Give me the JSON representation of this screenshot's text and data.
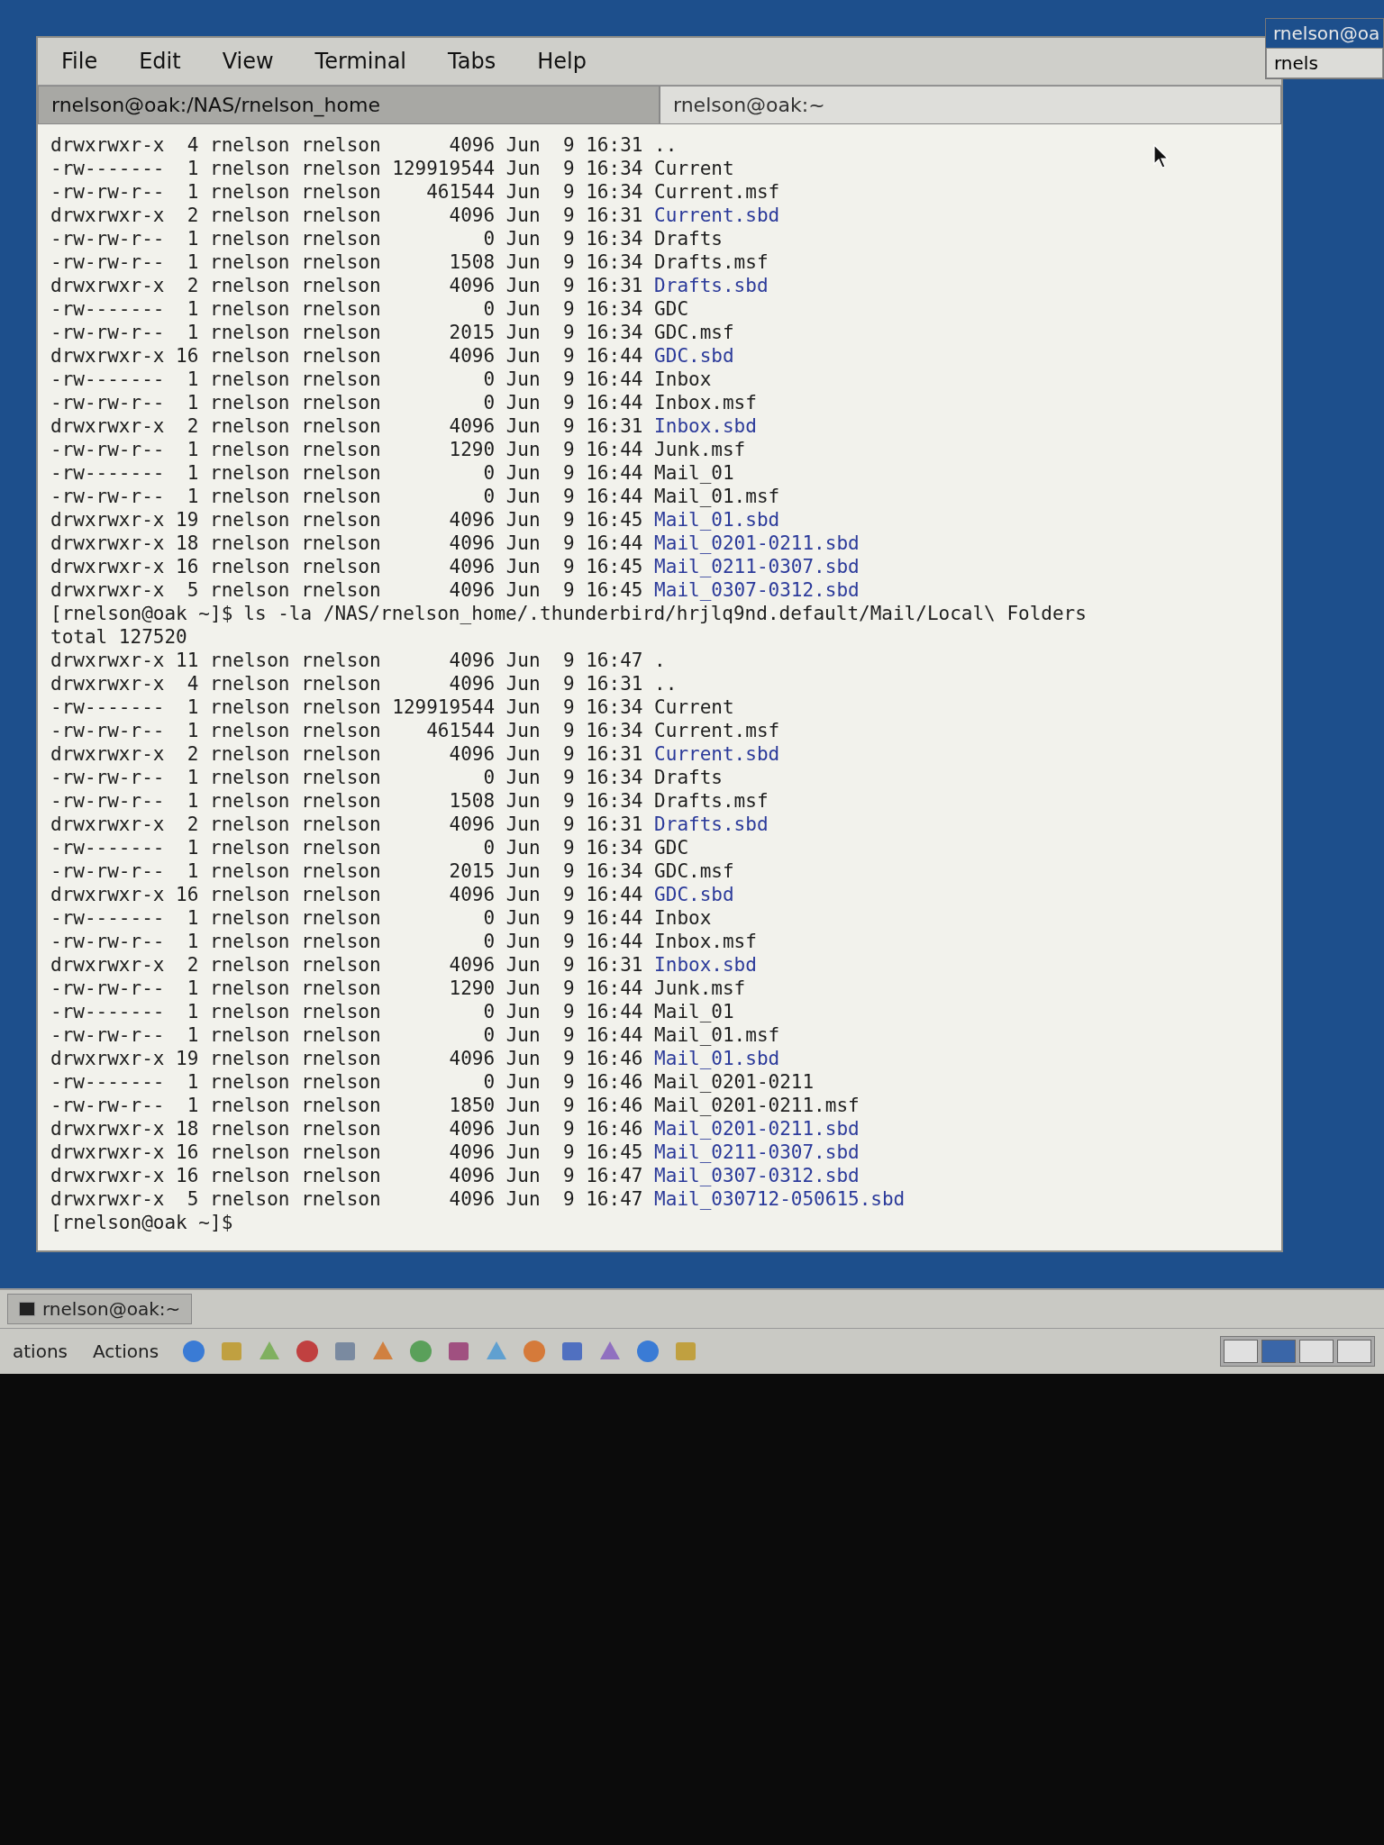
{
  "window": {
    "menu": [
      "File",
      "Edit",
      "View",
      "Terminal",
      "Tabs",
      "Help"
    ],
    "tabs": [
      {
        "label": "rnelson@oak:/NAS/rnelson_home",
        "selected": true
      },
      {
        "label": "rnelson@oak:~",
        "selected": false
      }
    ]
  },
  "background_window": {
    "title": "rnelson@oa",
    "tab": "rnels"
  },
  "terminal": {
    "lines": [
      {
        "kind": "entry",
        "mode": "drwxrwxr-x",
        "links": "4",
        "owner": "rnelson",
        "group": "rnelson",
        "size": "4096",
        "month": "Jun",
        "day": "9",
        "time": "16:31",
        "name": "..",
        "color": "#1e1e1e"
      },
      {
        "kind": "entry",
        "mode": "-rw-------",
        "links": "1",
        "owner": "rnelson",
        "group": "rnelson",
        "size": "129919544",
        "month": "Jun",
        "day": "9",
        "time": "16:34",
        "name": "Current",
        "color": "#1e1e1e"
      },
      {
        "kind": "entry",
        "mode": "-rw-rw-r--",
        "links": "1",
        "owner": "rnelson",
        "group": "rnelson",
        "size": "461544",
        "month": "Jun",
        "day": "9",
        "time": "16:34",
        "name": "Current.msf",
        "color": "#1e1e1e"
      },
      {
        "kind": "entry",
        "mode": "drwxrwxr-x",
        "links": "2",
        "owner": "rnelson",
        "group": "rnelson",
        "size": "4096",
        "month": "Jun",
        "day": "9",
        "time": "16:31",
        "name": "Current.sbd",
        "color": "#2b3a9a"
      },
      {
        "kind": "entry",
        "mode": "-rw-rw-r--",
        "links": "1",
        "owner": "rnelson",
        "group": "rnelson",
        "size": "0",
        "month": "Jun",
        "day": "9",
        "time": "16:34",
        "name": "Drafts",
        "color": "#1e1e1e"
      },
      {
        "kind": "entry",
        "mode": "-rw-rw-r--",
        "links": "1",
        "owner": "rnelson",
        "group": "rnelson",
        "size": "1508",
        "month": "Jun",
        "day": "9",
        "time": "16:34",
        "name": "Drafts.msf",
        "color": "#1e1e1e"
      },
      {
        "kind": "entry",
        "mode": "drwxrwxr-x",
        "links": "2",
        "owner": "rnelson",
        "group": "rnelson",
        "size": "4096",
        "month": "Jun",
        "day": "9",
        "time": "16:31",
        "name": "Drafts.sbd",
        "color": "#2b3a9a"
      },
      {
        "kind": "entry",
        "mode": "-rw-------",
        "links": "1",
        "owner": "rnelson",
        "group": "rnelson",
        "size": "0",
        "month": "Jun",
        "day": "9",
        "time": "16:34",
        "name": "GDC",
        "color": "#1e1e1e"
      },
      {
        "kind": "entry",
        "mode": "-rw-rw-r--",
        "links": "1",
        "owner": "rnelson",
        "group": "rnelson",
        "size": "2015",
        "month": "Jun",
        "day": "9",
        "time": "16:34",
        "name": "GDC.msf",
        "color": "#1e1e1e"
      },
      {
        "kind": "entry",
        "mode": "drwxrwxr-x",
        "links": "16",
        "owner": "rnelson",
        "group": "rnelson",
        "size": "4096",
        "month": "Jun",
        "day": "9",
        "time": "16:44",
        "name": "GDC.sbd",
        "color": "#2b3a9a"
      },
      {
        "kind": "entry",
        "mode": "-rw-------",
        "links": "1",
        "owner": "rnelson",
        "group": "rnelson",
        "size": "0",
        "month": "Jun",
        "day": "9",
        "time": "16:44",
        "name": "Inbox",
        "color": "#1e1e1e"
      },
      {
        "kind": "entry",
        "mode": "-rw-rw-r--",
        "links": "1",
        "owner": "rnelson",
        "group": "rnelson",
        "size": "0",
        "month": "Jun",
        "day": "9",
        "time": "16:44",
        "name": "Inbox.msf",
        "color": "#1e1e1e"
      },
      {
        "kind": "entry",
        "mode": "drwxrwxr-x",
        "links": "2",
        "owner": "rnelson",
        "group": "rnelson",
        "size": "4096",
        "month": "Jun",
        "day": "9",
        "time": "16:31",
        "name": "Inbox.sbd",
        "color": "#2b3a9a"
      },
      {
        "kind": "entry",
        "mode": "-rw-rw-r--",
        "links": "1",
        "owner": "rnelson",
        "group": "rnelson",
        "size": "1290",
        "month": "Jun",
        "day": "9",
        "time": "16:44",
        "name": "Junk.msf",
        "color": "#1e1e1e"
      },
      {
        "kind": "entry",
        "mode": "-rw-------",
        "links": "1",
        "owner": "rnelson",
        "group": "rnelson",
        "size": "0",
        "month": "Jun",
        "day": "9",
        "time": "16:44",
        "name": "Mail_01",
        "color": "#1e1e1e"
      },
      {
        "kind": "entry",
        "mode": "-rw-rw-r--",
        "links": "1",
        "owner": "rnelson",
        "group": "rnelson",
        "size": "0",
        "month": "Jun",
        "day": "9",
        "time": "16:44",
        "name": "Mail_01.msf",
        "color": "#1e1e1e"
      },
      {
        "kind": "entry",
        "mode": "drwxrwxr-x",
        "links": "19",
        "owner": "rnelson",
        "group": "rnelson",
        "size": "4096",
        "month": "Jun",
        "day": "9",
        "time": "16:45",
        "name": "Mail_01.sbd",
        "color": "#2b3a9a"
      },
      {
        "kind": "entry",
        "mode": "drwxrwxr-x",
        "links": "18",
        "owner": "rnelson",
        "group": "rnelson",
        "size": "4096",
        "month": "Jun",
        "day": "9",
        "time": "16:44",
        "name": "Mail_0201-0211.sbd",
        "color": "#2b3a9a"
      },
      {
        "kind": "entry",
        "mode": "drwxrwxr-x",
        "links": "16",
        "owner": "rnelson",
        "group": "rnelson",
        "size": "4096",
        "month": "Jun",
        "day": "9",
        "time": "16:45",
        "name": "Mail_0211-0307.sbd",
        "color": "#2b3a9a"
      },
      {
        "kind": "entry",
        "mode": "drwxrwxr-x",
        "links": "5",
        "owner": "rnelson",
        "group": "rnelson",
        "size": "4096",
        "month": "Jun",
        "day": "9",
        "time": "16:45",
        "name": "Mail_0307-0312.sbd",
        "color": "#2b3a9a"
      },
      {
        "kind": "prompt",
        "prompt": "[rnelson@oak ~]$",
        "command": "ls -la /NAS/rnelson_home/.thunderbird/hrjlq9nd.default/Mail/Local\\ Folders"
      },
      {
        "kind": "text",
        "text": "total 127520"
      },
      {
        "kind": "entry",
        "mode": "drwxrwxr-x",
        "links": "11",
        "owner": "rnelson",
        "group": "rnelson",
        "size": "4096",
        "month": "Jun",
        "day": "9",
        "time": "16:47",
        "name": ".",
        "color": "#1e1e1e"
      },
      {
        "kind": "entry",
        "mode": "drwxrwxr-x",
        "links": "4",
        "owner": "rnelson",
        "group": "rnelson",
        "size": "4096",
        "month": "Jun",
        "day": "9",
        "time": "16:31",
        "name": "..",
        "color": "#1e1e1e"
      },
      {
        "kind": "entry",
        "mode": "-rw-------",
        "links": "1",
        "owner": "rnelson",
        "group": "rnelson",
        "size": "129919544",
        "month": "Jun",
        "day": "9",
        "time": "16:34",
        "name": "Current",
        "color": "#1e1e1e"
      },
      {
        "kind": "entry",
        "mode": "-rw-rw-r--",
        "links": "1",
        "owner": "rnelson",
        "group": "rnelson",
        "size": "461544",
        "month": "Jun",
        "day": "9",
        "time": "16:34",
        "name": "Current.msf",
        "color": "#1e1e1e"
      },
      {
        "kind": "entry",
        "mode": "drwxrwxr-x",
        "links": "2",
        "owner": "rnelson",
        "group": "rnelson",
        "size": "4096",
        "month": "Jun",
        "day": "9",
        "time": "16:31",
        "name": "Current.sbd",
        "color": "#2b3a9a"
      },
      {
        "kind": "entry",
        "mode": "-rw-rw-r--",
        "links": "1",
        "owner": "rnelson",
        "group": "rnelson",
        "size": "0",
        "month": "Jun",
        "day": "9",
        "time": "16:34",
        "name": "Drafts",
        "color": "#1e1e1e"
      },
      {
        "kind": "entry",
        "mode": "-rw-rw-r--",
        "links": "1",
        "owner": "rnelson",
        "group": "rnelson",
        "size": "1508",
        "month": "Jun",
        "day": "9",
        "time": "16:34",
        "name": "Drafts.msf",
        "color": "#1e1e1e"
      },
      {
        "kind": "entry",
        "mode": "drwxrwxr-x",
        "links": "2",
        "owner": "rnelson",
        "group": "rnelson",
        "size": "4096",
        "month": "Jun",
        "day": "9",
        "time": "16:31",
        "name": "Drafts.sbd",
        "color": "#2b3a9a"
      },
      {
        "kind": "entry",
        "mode": "-rw-------",
        "links": "1",
        "owner": "rnelson",
        "group": "rnelson",
        "size": "0",
        "month": "Jun",
        "day": "9",
        "time": "16:34",
        "name": "GDC",
        "color": "#1e1e1e"
      },
      {
        "kind": "entry",
        "mode": "-rw-rw-r--",
        "links": "1",
        "owner": "rnelson",
        "group": "rnelson",
        "size": "2015",
        "month": "Jun",
        "day": "9",
        "time": "16:34",
        "name": "GDC.msf",
        "color": "#1e1e1e"
      },
      {
        "kind": "entry",
        "mode": "drwxrwxr-x",
        "links": "16",
        "owner": "rnelson",
        "group": "rnelson",
        "size": "4096",
        "month": "Jun",
        "day": "9",
        "time": "16:44",
        "name": "GDC.sbd",
        "color": "#2b3a9a"
      },
      {
        "kind": "entry",
        "mode": "-rw-------",
        "links": "1",
        "owner": "rnelson",
        "group": "rnelson",
        "size": "0",
        "month": "Jun",
        "day": "9",
        "time": "16:44",
        "name": "Inbox",
        "color": "#1e1e1e"
      },
      {
        "kind": "entry",
        "mode": "-rw-rw-r--",
        "links": "1",
        "owner": "rnelson",
        "group": "rnelson",
        "size": "0",
        "month": "Jun",
        "day": "9",
        "time": "16:44",
        "name": "Inbox.msf",
        "color": "#1e1e1e"
      },
      {
        "kind": "entry",
        "mode": "drwxrwxr-x",
        "links": "2",
        "owner": "rnelson",
        "group": "rnelson",
        "size": "4096",
        "month": "Jun",
        "day": "9",
        "time": "16:31",
        "name": "Inbox.sbd",
        "color": "#2b3a9a"
      },
      {
        "kind": "entry",
        "mode": "-rw-rw-r--",
        "links": "1",
        "owner": "rnelson",
        "group": "rnelson",
        "size": "1290",
        "month": "Jun",
        "day": "9",
        "time": "16:44",
        "name": "Junk.msf",
        "color": "#1e1e1e"
      },
      {
        "kind": "entry",
        "mode": "-rw-------",
        "links": "1",
        "owner": "rnelson",
        "group": "rnelson",
        "size": "0",
        "month": "Jun",
        "day": "9",
        "time": "16:44",
        "name": "Mail_01",
        "color": "#1e1e1e"
      },
      {
        "kind": "entry",
        "mode": "-rw-rw-r--",
        "links": "1",
        "owner": "rnelson",
        "group": "rnelson",
        "size": "0",
        "month": "Jun",
        "day": "9",
        "time": "16:44",
        "name": "Mail_01.msf",
        "color": "#1e1e1e"
      },
      {
        "kind": "entry",
        "mode": "drwxrwxr-x",
        "links": "19",
        "owner": "rnelson",
        "group": "rnelson",
        "size": "4096",
        "month": "Jun",
        "day": "9",
        "time": "16:46",
        "name": "Mail_01.sbd",
        "color": "#2b3a9a"
      },
      {
        "kind": "entry",
        "mode": "-rw-------",
        "links": "1",
        "owner": "rnelson",
        "group": "rnelson",
        "size": "0",
        "month": "Jun",
        "day": "9",
        "time": "16:46",
        "name": "Mail_0201-0211",
        "color": "#1e1e1e"
      },
      {
        "kind": "entry",
        "mode": "-rw-rw-r--",
        "links": "1",
        "owner": "rnelson",
        "group": "rnelson",
        "size": "1850",
        "month": "Jun",
        "day": "9",
        "time": "16:46",
        "name": "Mail_0201-0211.msf",
        "color": "#1e1e1e"
      },
      {
        "kind": "entry",
        "mode": "drwxrwxr-x",
        "links": "18",
        "owner": "rnelson",
        "group": "rnelson",
        "size": "4096",
        "month": "Jun",
        "day": "9",
        "time": "16:46",
        "name": "Mail_0201-0211.sbd",
        "color": "#2b3a9a"
      },
      {
        "kind": "entry",
        "mode": "drwxrwxr-x",
        "links": "16",
        "owner": "rnelson",
        "group": "rnelson",
        "size": "4096",
        "month": "Jun",
        "day": "9",
        "time": "16:45",
        "name": "Mail_0211-0307.sbd",
        "color": "#2b3a9a"
      },
      {
        "kind": "entry",
        "mode": "drwxrwxr-x",
        "links": "16",
        "owner": "rnelson",
        "group": "rnelson",
        "size": "4096",
        "month": "Jun",
        "day": "9",
        "time": "16:47",
        "name": "Mail_0307-0312.sbd",
        "color": "#2b3a9a"
      },
      {
        "kind": "entry",
        "mode": "drwxrwxr-x",
        "links": "5",
        "owner": "rnelson",
        "group": "rnelson",
        "size": "4096",
        "month": "Jun",
        "day": "9",
        "time": "16:47",
        "name": "Mail_030712-050615.sbd",
        "color": "#2b3a9a"
      },
      {
        "kind": "prompt",
        "prompt": "[rnelson@oak ~]$"
      }
    ]
  },
  "taskbar": {
    "task_button": "rnelson@oak:~",
    "menus": [
      "ations",
      "Actions"
    ]
  }
}
